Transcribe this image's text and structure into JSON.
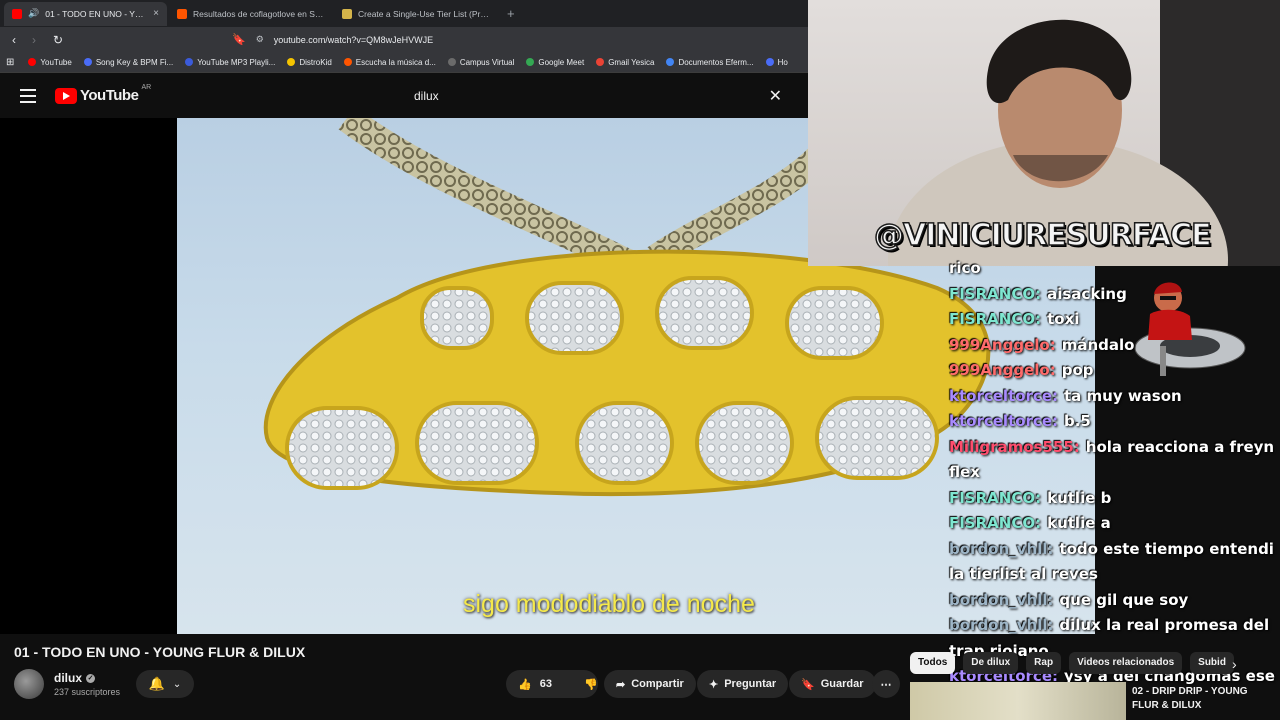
{
  "browser": {
    "tabs": [
      {
        "label": "01 - TODO EN UNO - YOUNG",
        "active": true,
        "favicon_color": "#ff0000"
      },
      {
        "label": "Resultados de coflagotlove en Sound",
        "active": false,
        "favicon_color": "#ff5500"
      },
      {
        "label": "Create a Single-Use Tier List (Private",
        "active": false,
        "favicon_color": "#d4b44a"
      }
    ],
    "new_tab_symbol": "+",
    "close_symbol": "×",
    "url": "youtube.com/watch?v=QM8wJeHVWJE",
    "bookmarks": [
      {
        "label": "YouTube",
        "color": "#ff0000"
      },
      {
        "label": "Song Key & BPM Fi...",
        "color": "#4a6cf7"
      },
      {
        "label": "YouTube MP3 Playli...",
        "color": "#3b5bdb"
      },
      {
        "label": "DistroKid",
        "color": "#f5c400"
      },
      {
        "label": "Escucha la música d...",
        "color": "#ff5500"
      },
      {
        "label": "Campus Virtual",
        "color": "#6b6b6b"
      },
      {
        "label": "Google Meet",
        "color": "#34a853"
      },
      {
        "label": "Gmail Yesica",
        "color": "#ea4335"
      },
      {
        "label": "Documentos Eferm...",
        "color": "#4285f4"
      },
      {
        "label": "Ho",
        "color": "#4a6cf7"
      }
    ]
  },
  "youtube": {
    "logo_text": "YouTube",
    "country_code": "AR",
    "search_value": "dilux",
    "clear_symbol": "✕"
  },
  "video": {
    "subtitle": "sigo mododiablo de noche",
    "title": "01 - TODO EN UNO - YOUNG FLUR & DILUX",
    "channel_name": "dilux",
    "subscribers": "237 suscriptores",
    "likes": "63",
    "actions": {
      "share": "Compartir",
      "ask": "Preguntar",
      "save": "Guardar"
    }
  },
  "stream": {
    "overlay_name": "@VINICIURESURFACE",
    "chat": [
      {
        "user": "",
        "text": "rico",
        "color": "#ffffff"
      },
      {
        "user": "FISRANCO:",
        "text": "aisacking",
        "color": "#7ee6d0"
      },
      {
        "user": "FISRANCO:",
        "text": "toxi",
        "color": "#7ee6d0"
      },
      {
        "user": "999Anggelo:",
        "text": "mándalo",
        "color": "#ff6b6b"
      },
      {
        "user": "999Anggelo:",
        "text": "pop",
        "color": "#ff6b6b"
      },
      {
        "user": "ktorceltorce:",
        "text": "ta muy wason",
        "color": "#a98bff"
      },
      {
        "user": "ktorceltorce:",
        "text": "b.5",
        "color": "#a98bff"
      },
      {
        "user": "Miligramos555:",
        "text": "hola reacciona a freyn flex",
        "color": "#ff4d6d"
      },
      {
        "user": "FISRANCO:",
        "text": "kutlie b",
        "color": "#7ee6d0"
      },
      {
        "user": "FISRANCO:",
        "text": "kutlie a",
        "color": "#7ee6d0"
      },
      {
        "user": "bordon_vhll:",
        "text": "todo este tiempo entendi la tierlist al reves",
        "color": "#9eb6c8"
      },
      {
        "user": "bordon_vhll:",
        "text": "que gil que soy",
        "color": "#9eb6c8"
      },
      {
        "user": "bordon_vhll:",
        "text": "dilux la real promesa del trap riojano",
        "color": "#9eb6c8"
      },
      {
        "user": "ktorceltorce:",
        "text": "ysy a del changomas ese visualizer",
        "color": "#a98bff"
      }
    ]
  },
  "sidebar": {
    "chips": [
      "Todos",
      "De dilux",
      "Rap",
      "Videos relacionados",
      "Subid"
    ],
    "chip_next_symbol": "›",
    "related": [
      {
        "title": "02 - DRIP DRIP - YOUNG FLUR & DILUX"
      }
    ]
  }
}
